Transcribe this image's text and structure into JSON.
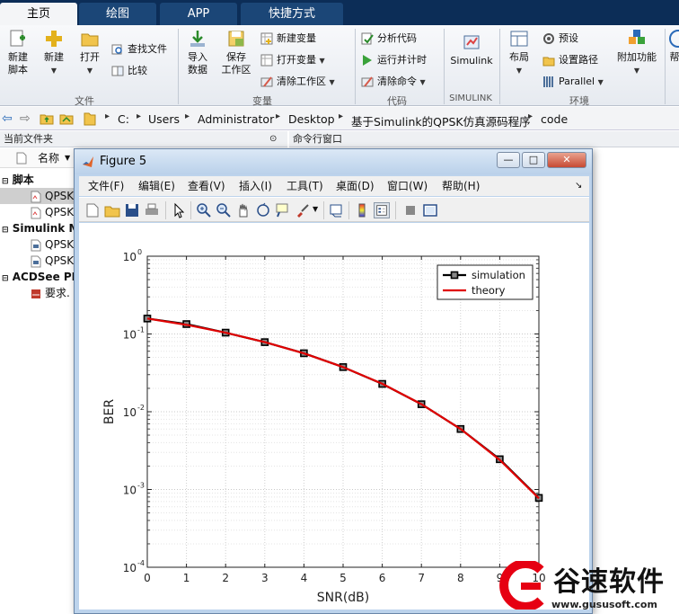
{
  "ribbon_tabs": [
    "主页",
    "绘图",
    "APP",
    "快捷方式"
  ],
  "ribbon": {
    "new_script": "新建\n脚本",
    "new": "新建",
    "open": "打开",
    "find_files": "查找文件",
    "compare": "比较",
    "import_data": "导入\n数据",
    "save_workspace": "保存\n工作区",
    "new_variable": "新建变量",
    "open_variable": "打开变量",
    "clear_workspace": "清除工作区",
    "analyze_code": "分析代码",
    "run_timer": "运行并计时",
    "clear_commands": "清除命令",
    "simulink": "Simulink",
    "layout": "布局",
    "preferences": "预设",
    "set_path": "设置路径",
    "parallel": "Parallel",
    "addons": "附加功能",
    "help_cut": "帮",
    "groups": {
      "file": "文件",
      "variable": "变量",
      "code": "代码",
      "simulink": "SIMULINK",
      "environment": "环境"
    }
  },
  "address": {
    "segments": [
      "C:",
      "Users",
      "Administrator",
      "Desktop",
      "基于Simulink的QPSK仿真源码程序",
      "code"
    ]
  },
  "panels": {
    "current_folder": "当前文件夹",
    "command_window": "命令行窗口"
  },
  "file_browser": {
    "name_header": "名称",
    "groups": [
      {
        "label": "脚本",
        "items": [
          "QPSK",
          "QPSK"
        ]
      },
      {
        "label": "Simulink M",
        "items": [
          "QPSK",
          "QPSK"
        ]
      },
      {
        "label": "ACDSee PN",
        "items": [
          "要求."
        ]
      }
    ]
  },
  "figure": {
    "title": "Figure 5",
    "menu": [
      "文件(F)",
      "编辑(E)",
      "查看(V)",
      "插入(I)",
      "工具(T)",
      "桌面(D)",
      "窗口(W)",
      "帮助(H)"
    ],
    "win_buttons": [
      "—",
      "□",
      "✕"
    ]
  },
  "chart_data": {
    "type": "line",
    "title": "",
    "xlabel": "SNR(dB)",
    "ylabel": "BER",
    "x": [
      0,
      1,
      2,
      3,
      4,
      5,
      6,
      7,
      8,
      9,
      10
    ],
    "xlim": [
      0,
      10
    ],
    "ylim": [
      0.0001,
      1
    ],
    "yscale": "log",
    "grid": true,
    "legend": "top-right",
    "x_ticks": [
      "0",
      "1",
      "2",
      "3",
      "4",
      "5",
      "6",
      "7",
      "8",
      "9",
      "10"
    ],
    "y_ticks": [
      "10",
      "10",
      "10",
      "10",
      "10"
    ],
    "y_tick_exps": [
      "0",
      "-1",
      "-2",
      "-3",
      "-4"
    ],
    "series": [
      {
        "name": "simulation",
        "color": "#000000",
        "marker": "square",
        "values": [
          0.158,
          0.134,
          0.104,
          0.0785,
          0.0565,
          0.0375,
          0.0228,
          0.0125,
          0.006,
          0.00245,
          0.00078
        ]
      },
      {
        "name": "theory",
        "color": "#e00000",
        "marker": "none",
        "values": [
          0.158,
          0.131,
          0.104,
          0.0786,
          0.0563,
          0.0375,
          0.0229,
          0.0125,
          0.006,
          0.0024,
          0.00077
        ]
      }
    ]
  },
  "watermark": {
    "text": "谷速软件",
    "url": "www.gususoft.com"
  }
}
